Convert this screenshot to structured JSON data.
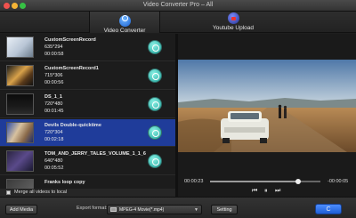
{
  "window": {
    "title": "Video Converter Pro – All"
  },
  "tabs": [
    {
      "label": "Video Converter",
      "active": true,
      "icon": "video-converter-icon"
    },
    {
      "label": "Youtube Upload",
      "active": false,
      "icon": "youtube-upload-icon"
    }
  ],
  "files": [
    {
      "name": "CustomScreenRecord",
      "resolution": "635*294",
      "duration": "00:00:58",
      "selected": false
    },
    {
      "name": "CustomScreenRecord1",
      "resolution": "715*306",
      "duration": "00:00:56",
      "selected": false
    },
    {
      "name": "DS_1_1",
      "resolution": "720*480",
      "duration": "00:01:45",
      "selected": false
    },
    {
      "name": "Devils Double-quicktime",
      "resolution": "720*304",
      "duration": "00:02:18",
      "selected": true
    },
    {
      "name": "TOM_AND_JERRY_TALES_VOLUME_1_1_6",
      "resolution": "640*480",
      "duration": "00:05:52",
      "selected": false
    },
    {
      "name": "Franks loop copy",
      "resolution": "",
      "duration": "",
      "selected": false
    }
  ],
  "merge": {
    "label": "Merge all videos to local",
    "checked": false
  },
  "player": {
    "current_time": "00:00:23",
    "remaining_time": "-00:00:05",
    "progress": 0.8,
    "controls": {
      "prev": "⏮",
      "pause": "⏸",
      "next": "⏭"
    }
  },
  "bottom": {
    "add_media": "Add Media",
    "export_label": "Export format:",
    "export_value": "MPEG-4 Movie(*.mp4)",
    "setting": "Setting",
    "convert": "C"
  },
  "colors": {
    "selected_row": "#1f3c9a",
    "convert_button": "#1f5fd6",
    "file_action": "#1da39a"
  }
}
